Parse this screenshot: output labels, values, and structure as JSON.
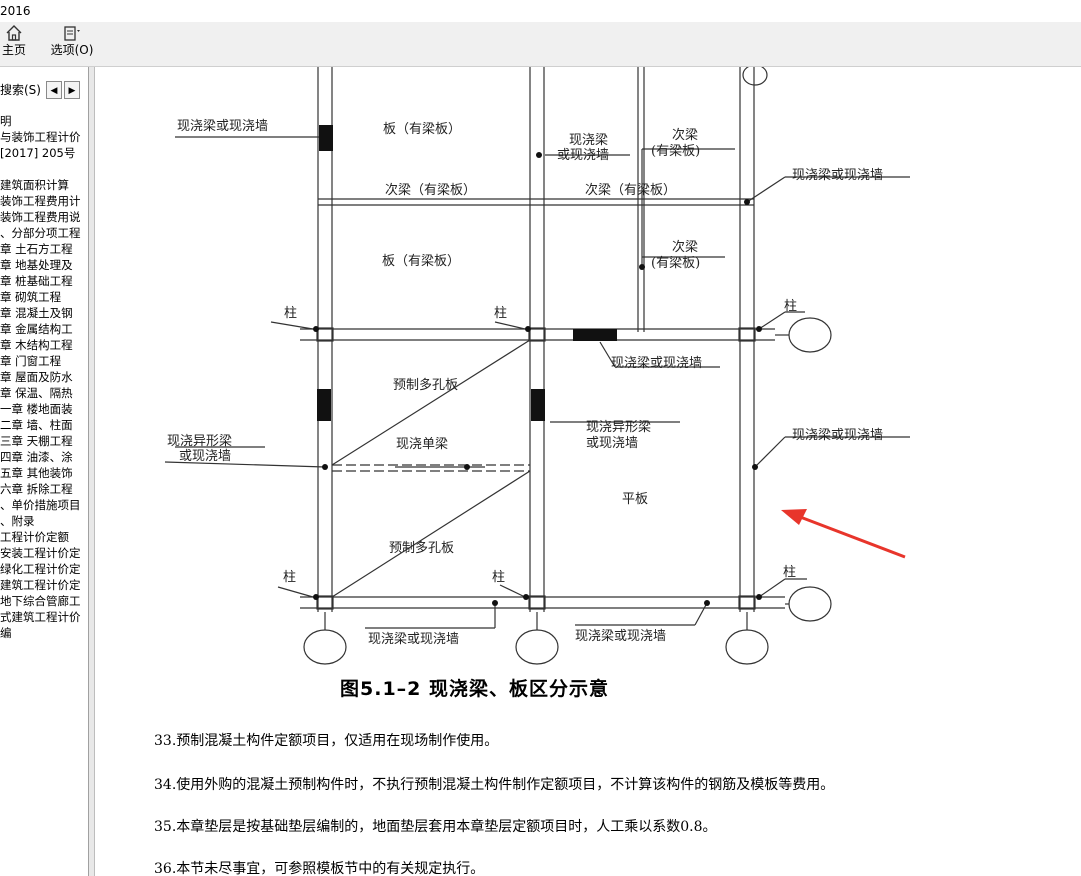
{
  "window": {
    "title": "2016"
  },
  "toolbar": {
    "home_label": "主页",
    "options_label": "选项(O)"
  },
  "sidebar": {
    "tab_label": "搜索(S)",
    "items": [
      "明",
      "与装饰工程计价",
      "[2017] 205号",
      "",
      "建筑面积计算",
      "装饰工程费用计",
      "装饰工程费用说",
      "、分部分项工程",
      "章 土石方工程",
      "章 地基处理及",
      "章 桩基础工程",
      "章 砌筑工程",
      "章 混凝土及钢",
      "章 金属结构工",
      "章 木结构工程",
      "章 门窗工程",
      "章 屋面及防水",
      "章 保温、隔热",
      "一章 楼地面装",
      "二章 墙、柱面",
      "三章 天棚工程",
      "四章 油漆、涂",
      "五章 其他装饰",
      "六章 拆除工程",
      "、单价措施项目",
      "、附录",
      "工程计价定额",
      "安装工程计价定",
      "绿化工程计价定",
      "建筑工程计价定",
      "地下综合管廊工",
      "式建筑工程计价",
      "编"
    ]
  },
  "diagram": {
    "labels": {
      "l1": "现浇梁或现浇墙",
      "l2": "板（有梁板）",
      "l3a": "现浇梁",
      "l3b": "或现浇墙",
      "l4a": "次梁",
      "l4b": "(有梁板)",
      "l5": "现浇梁或现浇墙",
      "l6": "次梁（有梁板）",
      "l7": "次梁（有梁板）",
      "l8": "板（有梁板）",
      "l9a": "次梁",
      "l9b": "(有梁板)",
      "l10": "柱",
      "l11": "柱",
      "l12": "柱",
      "l13": "现浇梁或现浇墙",
      "l14": "预制多孔板",
      "l15a": "现浇异形梁",
      "l15b": "或现浇墙",
      "l16": "现浇单梁",
      "l17a": "现浇异形梁",
      "l17b": "或现浇墙",
      "l18": "现浇梁或现浇墙",
      "l19": "平板",
      "l20": "预制多孔板",
      "l21": "柱",
      "l22": "柱",
      "l23": "柱",
      "l24": "现浇梁或现浇墙",
      "l25": "现浇梁或现浇墙"
    },
    "caption": "图5.1–2    现浇梁、板区分示意",
    "accent_color": "#e8352b"
  },
  "paragraphs": [
    "33.预制混凝土构件定额项目，仅适用在现场制作使用。",
    "34.使用外购的混凝土预制构件时，不执行预制混凝土构件制作定额项目，不计算该构件的钢筋及模板等费用。",
    "35.本章垫层是按基础垫层编制的，地面垫层套用本章垫层定额项目时，人工乘以系数0.8。",
    "36.本节未尽事宜，可参照模板节中的有关规定执行。"
  ]
}
